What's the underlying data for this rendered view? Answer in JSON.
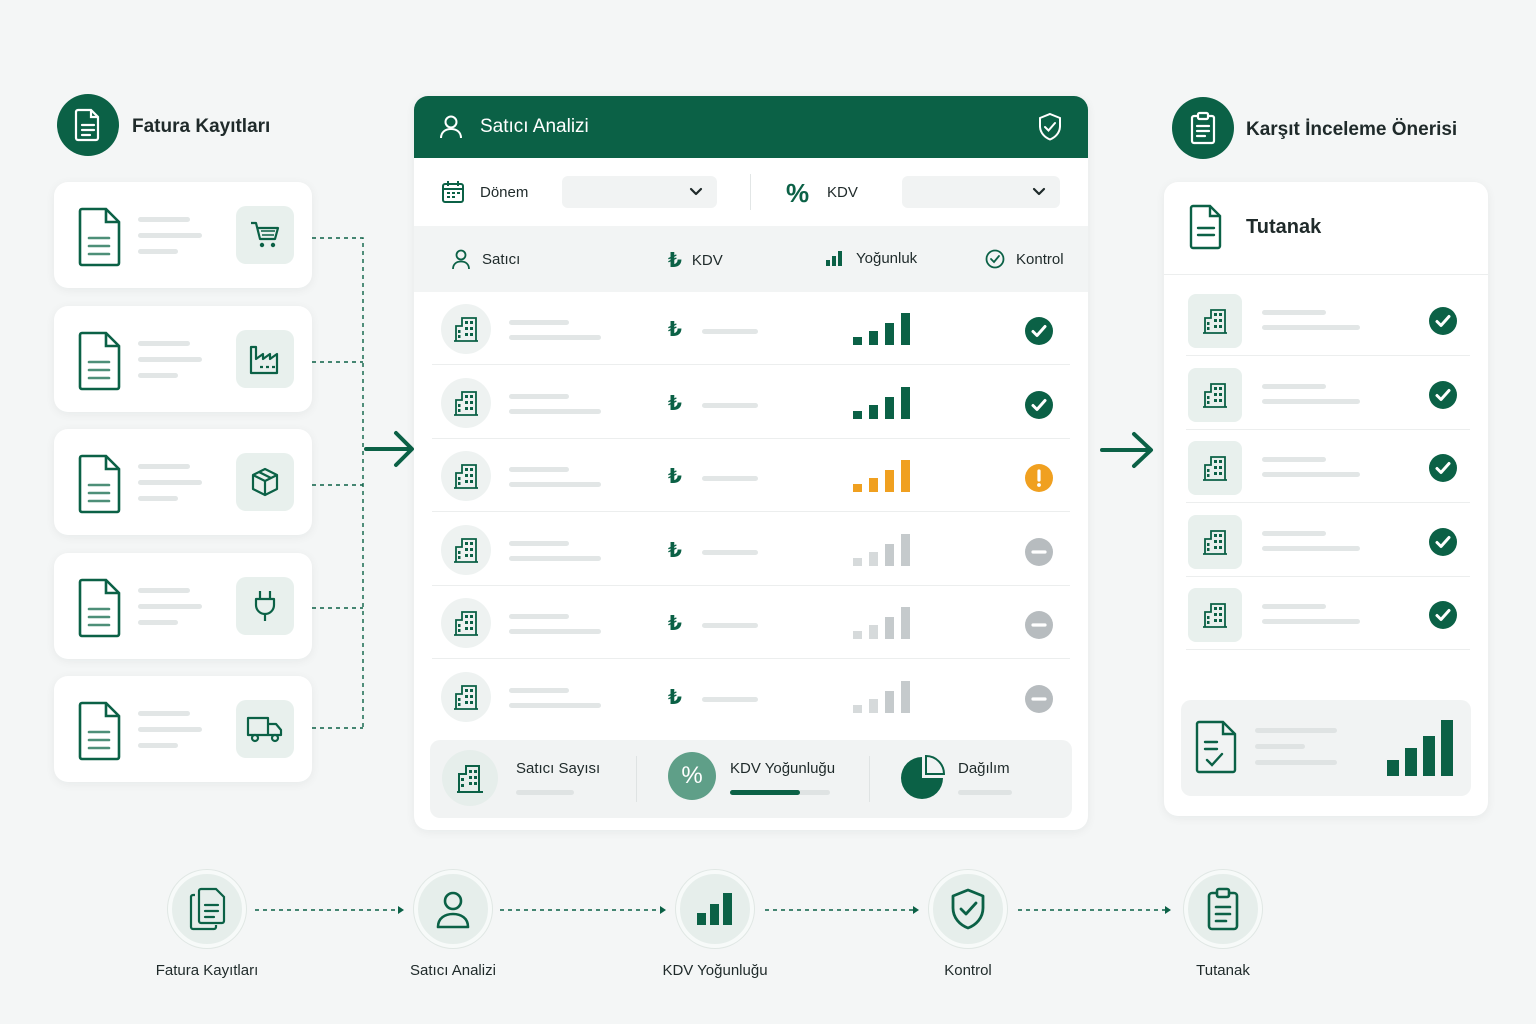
{
  "left_section": {
    "title": "Fatura Kayıtları",
    "cards": [
      {
        "icon": "cart-icon"
      },
      {
        "icon": "factory-icon"
      },
      {
        "icon": "box-icon"
      },
      {
        "icon": "plug-icon"
      },
      {
        "icon": "truck-icon"
      }
    ]
  },
  "center_panel": {
    "title": "Satıcı Analizi",
    "filters": {
      "period_label": "Dönem",
      "period_value": "",
      "vat_label": "KDV",
      "vat_value": ""
    },
    "columns": [
      "Satıcı",
      "KDV",
      "Yoğunluk",
      "Kontrol"
    ],
    "rows": [
      {
        "intensity": 1.0,
        "level": "high",
        "status": "check"
      },
      {
        "intensity": 1.0,
        "level": "high",
        "status": "check"
      },
      {
        "intensity": 1.0,
        "level": "warning",
        "status": "warning"
      },
      {
        "intensity": 1.0,
        "level": "low",
        "status": "neutral"
      },
      {
        "intensity": 1.0,
        "level": "low",
        "status": "neutral"
      },
      {
        "intensity": 1.0,
        "level": "low",
        "status": "neutral"
      }
    ],
    "row_currency_symbol": "₺",
    "summary": {
      "seller_count_label": "Satıcı Sayısı",
      "vat_intensity_label": "KDV Yoğunluğu",
      "vat_intensity_fill": 0.7,
      "distribution_label": "Dağılım"
    }
  },
  "right_section": {
    "title": "Karşıt İnceleme Önerisi",
    "report_title": "Tutanak",
    "rows": [
      {
        "status": "check"
      },
      {
        "status": "check"
      },
      {
        "status": "check"
      },
      {
        "status": "check"
      },
      {
        "status": "check"
      }
    ]
  },
  "flow": {
    "steps": [
      {
        "label": "Fatura Kayıtları",
        "icon": "documents-icon"
      },
      {
        "label": "Satıcı Analizi",
        "icon": "user-icon"
      },
      {
        "label": "KDV Yoğunluğu",
        "icon": "bar-chart-icon"
      },
      {
        "label": "Kontrol",
        "icon": "shield-check-icon"
      },
      {
        "label": "Tutanak",
        "icon": "clipboard-icon"
      }
    ]
  },
  "colors": {
    "brand": "#0b6146",
    "warning": "#f0a020",
    "neutral": "#b7bcbf",
    "panel_bg": "#ffffff",
    "page_bg": "#f4f6f6"
  }
}
